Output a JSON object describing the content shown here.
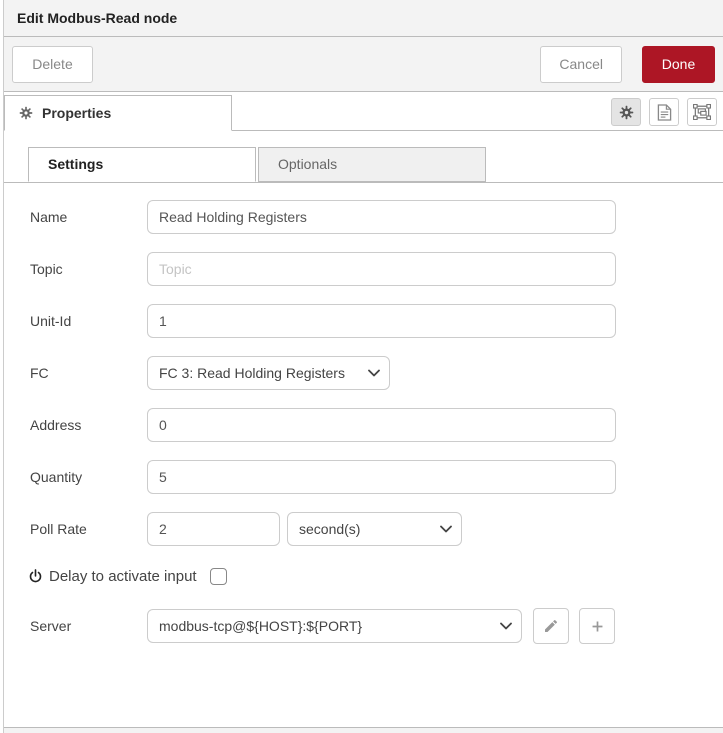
{
  "dialog": {
    "title": "Edit Modbus-Read node"
  },
  "toolbar": {
    "delete": "Delete",
    "cancel": "Cancel",
    "done": "Done"
  },
  "editor_tabs": {
    "properties": "Properties"
  },
  "inner_tabs": {
    "settings": "Settings",
    "optionals": "Optionals"
  },
  "form": {
    "name": {
      "label": "Name",
      "value": "Read Holding Registers"
    },
    "topic": {
      "label": "Topic",
      "placeholder": "Topic"
    },
    "unit_id": {
      "label": "Unit-Id",
      "value": "1"
    },
    "fc": {
      "label": "FC",
      "value": "FC 3: Read Holding Registers"
    },
    "address": {
      "label": "Address",
      "value": "0"
    },
    "quantity": {
      "label": "Quantity",
      "value": "5"
    },
    "poll_rate": {
      "label": "Poll Rate",
      "value": "2",
      "unit": "second(s)"
    },
    "delay": {
      "label": "Delay to activate input",
      "checked": false
    },
    "server": {
      "label": "Server",
      "value": "modbus-tcp@${HOST}:${PORT}"
    }
  },
  "icons": {
    "gear": "gear glyph (settings)",
    "document": "document sheet glyph",
    "appearance": "object-group frame glyph",
    "power": "power symbol",
    "pencil": "edit pencil",
    "plus": "plus sign",
    "chevron": "chevron-down"
  },
  "colors": {
    "accent": "#AD1625",
    "header_bg": "#f3f3f3",
    "border": "#bbbbbb",
    "input_border": "#cccccc"
  }
}
